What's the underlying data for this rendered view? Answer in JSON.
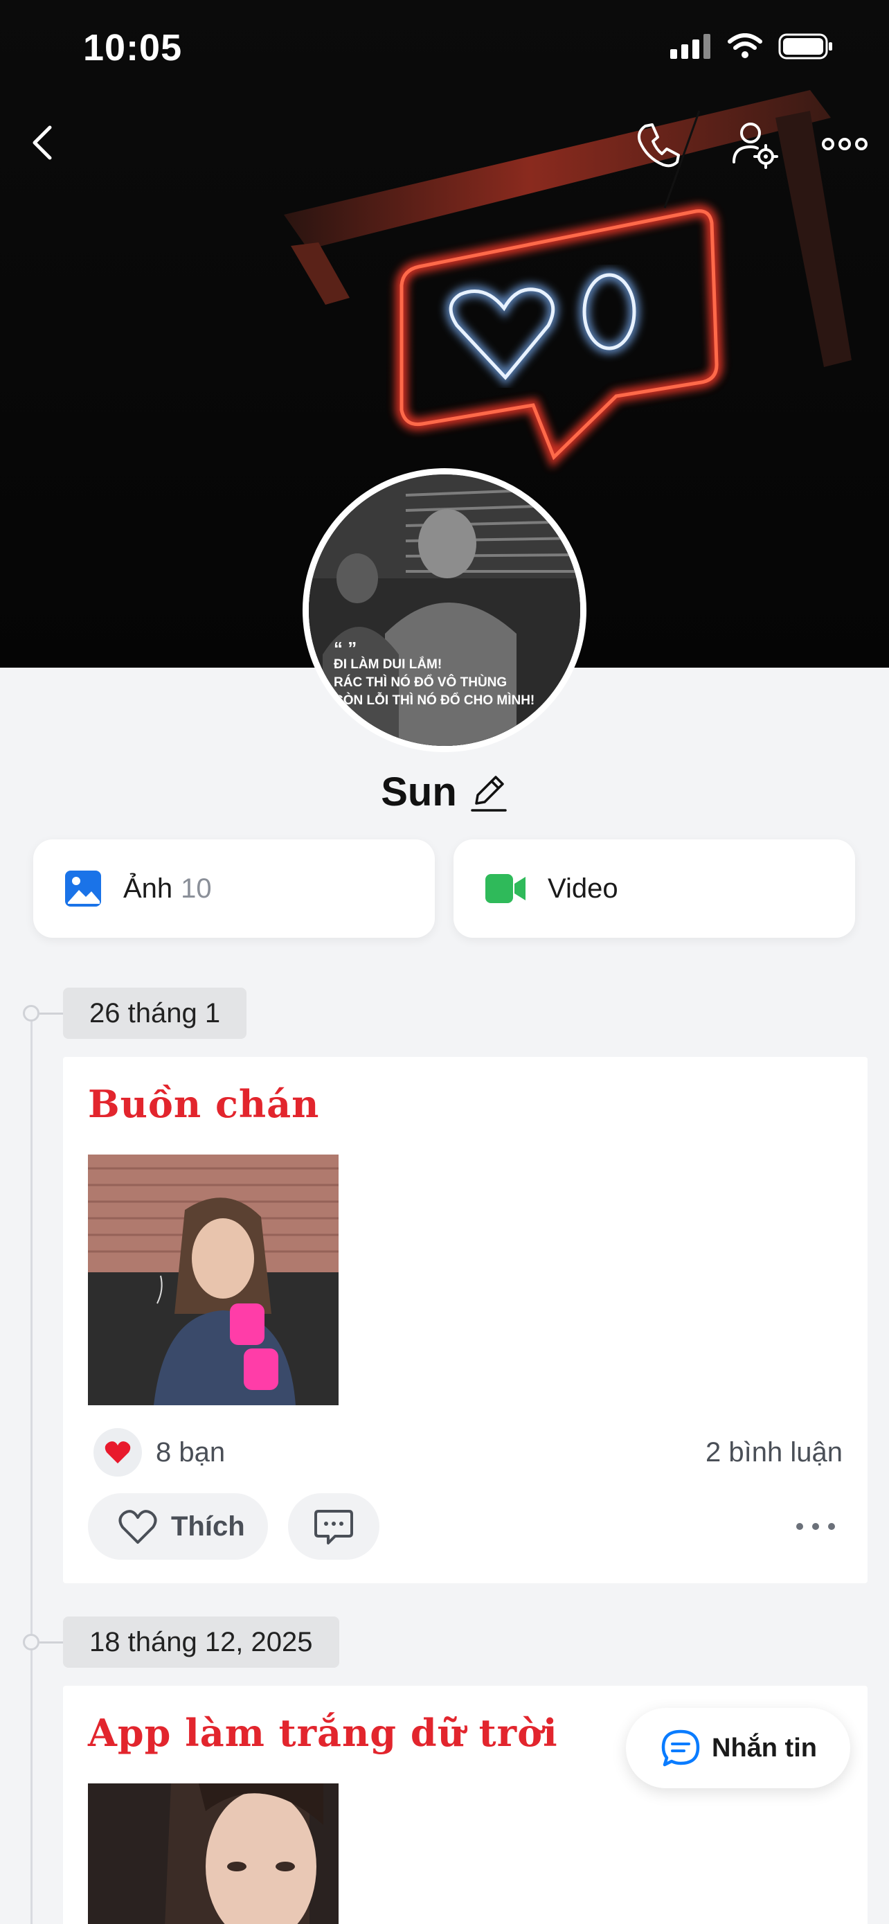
{
  "status_bar": {
    "time": "10:05"
  },
  "profile": {
    "name": "Sun",
    "avatar_caption": [
      "ĐI LÀM DUI LẮM!",
      "RÁC THÌ NÓ ĐỔ VÔ THÙNG",
      "CÒN LỖI THÌ NÓ ĐỔ CHO MÌNH!"
    ]
  },
  "media": {
    "photos": {
      "label": "Ảnh",
      "count": "10"
    },
    "videos": {
      "label": "Video"
    }
  },
  "posts": [
    {
      "date": "26 tháng 1",
      "title": "Buồn chán",
      "reactions": "8 bạn",
      "comments": "2 bình luận",
      "like_label": "Thích"
    },
    {
      "date": "18 tháng 12, 2025",
      "title": "App làm trắng dữ trời"
    }
  ],
  "message_button": {
    "label": "Nhắn tin"
  },
  "colors": {
    "accent_red": "#e2252d",
    "photo_icon_blue": "#1a73e8",
    "video_icon_green": "#2fba5a",
    "message_icon_blue": "#0a7cff"
  }
}
